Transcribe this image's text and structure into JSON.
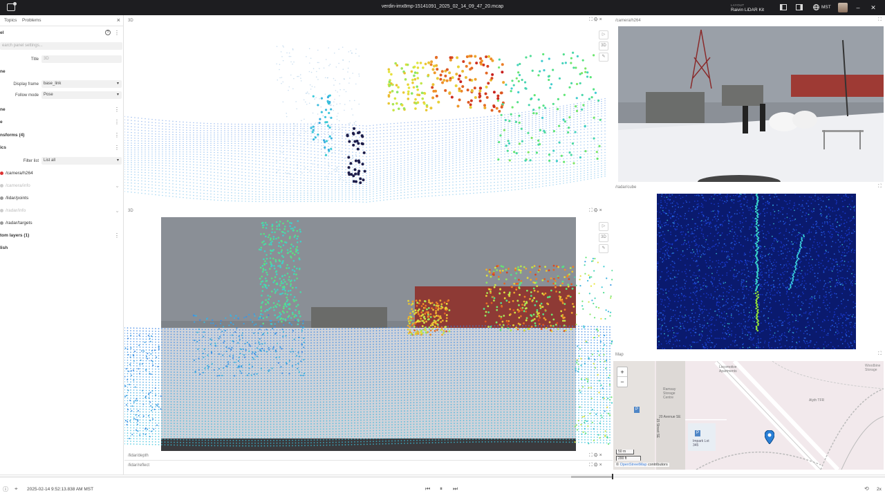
{
  "window": {
    "file_name": "verdin-imx8mp-15141091_2025_02_14_09_47_20.mcap",
    "layout_label": "LAYOUT",
    "layout_name": "Raivin LiDAR Kit",
    "timezone": "MST"
  },
  "sidebar": {
    "tabs": [
      "Topics",
      "Problems"
    ],
    "section_panel": "el",
    "search_placeholder": "earch panel settings...",
    "title_label": "Title",
    "title_placeholder": "3D",
    "section_frame": "ne",
    "display_frame_label": "Display frame",
    "display_frame_value": "base_link",
    "follow_mode_label": "Follow mode",
    "follow_mode_value": "Pose",
    "section_scene": "ne",
    "section_grid": "e",
    "section_transforms": "nsforms (4)",
    "section_topics": "ics",
    "filter_label": "Filter list",
    "filter_value": "List all",
    "topics": [
      "/camera/h264",
      "/camera/info",
      "/lidar/points",
      "/radar/info",
      "/radar/targets"
    ],
    "section_custom": "tom layers (1)",
    "publish": "lish"
  },
  "panels": {
    "top_3d_title": "3D",
    "bottom_3d_title": "3D",
    "camera_title": "/camera/h264",
    "radar_title": "/radar/cube",
    "map_title": "Map",
    "lidar_depth_title": "/lidar/depth",
    "lidar_reflect_title": "/lidar/reflect"
  },
  "map": {
    "zoom_in": "+",
    "zoom_out": "−",
    "labels": [
      "Locomotive Apartments",
      "Ramsay Storage Centre",
      "Alyth TFR",
      "Woodbine Storage",
      "20 Avenue SE",
      "15 Street SE",
      "Impark Lot 345",
      "P",
      "P"
    ],
    "scale_m": "50 m",
    "scale_ft": "200 ft",
    "attribution_prefix": "©",
    "attribution_link": "OpenStreetMap",
    "attribution_suffix": "contributors"
  },
  "playback": {
    "timestamp": "2025-02-14 9:52:13.838 AM MST",
    "speed": "2x"
  },
  "colors": {
    "titlebar": "#1d1d20",
    "link": "#3a7bd5",
    "radar_bg": "#0a1a6e",
    "map_bg": "#f2e9ec"
  }
}
